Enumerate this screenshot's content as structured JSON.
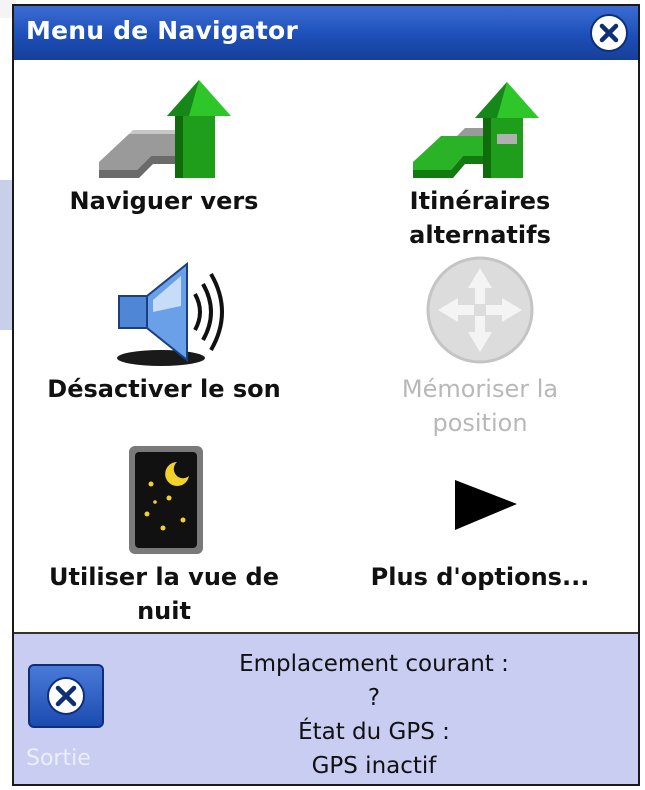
{
  "window": {
    "title": "Menu de Navigator"
  },
  "menu": {
    "items": [
      {
        "label_line1": "Naviguer vers",
        "label_line2": "",
        "icon": "navigate-arrow-icon",
        "enabled": true
      },
      {
        "label_line1": "Itinéraires",
        "label_line2": "alternatifs",
        "icon": "alternative-routes-icon",
        "enabled": true
      },
      {
        "label_line1": "Désactiver le son",
        "label_line2": "",
        "icon": "speaker-icon",
        "enabled": true
      },
      {
        "label_line1": "Mémoriser la",
        "label_line2": "position",
        "icon": "save-position-icon",
        "enabled": false
      },
      {
        "label_line1": "Utiliser la vue de",
        "label_line2": "nuit",
        "icon": "night-view-icon",
        "enabled": true
      },
      {
        "label_line1": "Plus d'options...",
        "label_line2": "",
        "icon": "play-arrow-icon",
        "enabled": true
      }
    ]
  },
  "status": {
    "exit_label": "Sortie",
    "location_label": "Emplacement courant :",
    "location_value": "?",
    "gps_label": "État du GPS :",
    "gps_value": "GPS inactif"
  },
  "colors": {
    "titlebar": "#1d4fb8",
    "status_bg": "#c9cdf1",
    "arrow_green": "#22b21e",
    "disabled_text": "#b8b8b8"
  }
}
